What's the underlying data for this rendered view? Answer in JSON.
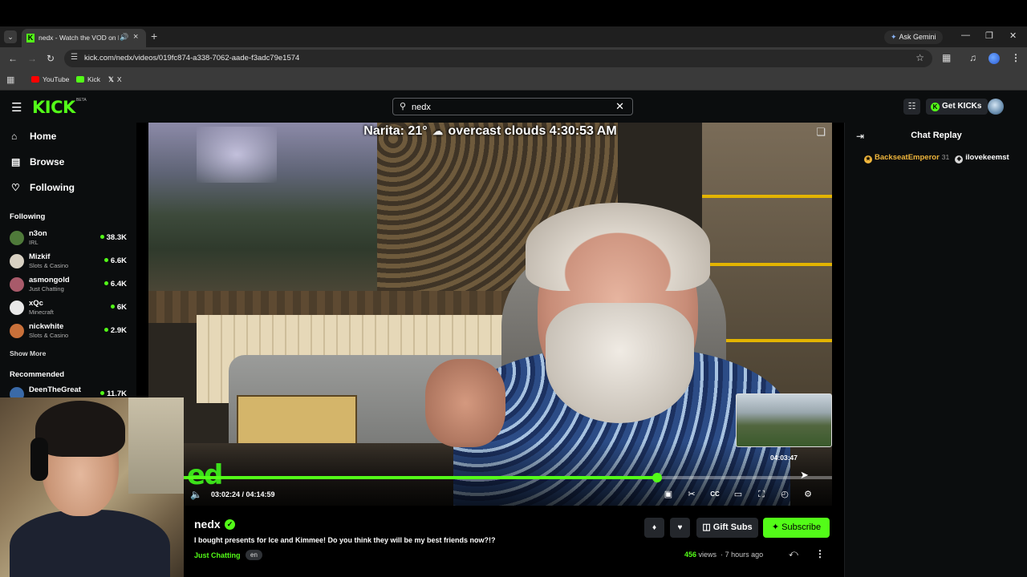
{
  "browser": {
    "tab_title": "nedx - Watch the VOD on Kick",
    "ask_gemini": "Ask Gemini",
    "url": "kick.com/nedx/videos/019fc874-a338-7062-aade-f3adc79e1574",
    "bookmarks": [
      "YouTube",
      "Kick",
      "X"
    ]
  },
  "header": {
    "logo": "KICK",
    "beta": "BETA",
    "search_value": "nedx",
    "get_kicks": "Get KICKs"
  },
  "sidebar": {
    "nav": [
      {
        "label": "Home",
        "icon": "home-icon"
      },
      {
        "label": "Browse",
        "icon": "browse-icon"
      },
      {
        "label": "Following",
        "icon": "heart-icon"
      }
    ],
    "following_heading": "Following",
    "following": [
      {
        "name": "n3on",
        "category": "IRL",
        "viewers": "38.3K",
        "color": "#4f7a3a"
      },
      {
        "name": "Mizkif",
        "category": "Slots & Casino",
        "viewers": "6.6K",
        "color": "#d8d1c2"
      },
      {
        "name": "asmongold",
        "category": "Just Chatting",
        "viewers": "6.4K",
        "color": "#a85a6a"
      },
      {
        "name": "xQc",
        "category": "Minecraft",
        "viewers": "6K",
        "color": "#e8e8e8"
      },
      {
        "name": "nickwhite",
        "category": "Slots & Casino",
        "viewers": "2.9K",
        "color": "#c8703a"
      }
    ],
    "show_more": "Show More",
    "recommended_heading": "Recommended",
    "recommended": [
      {
        "name": "DeenTheGreat",
        "viewers": "11.7K",
        "color": "#3a6aa8"
      }
    ]
  },
  "player": {
    "overlay_prefix": "Narita: 21°",
    "overlay_suffix": "overcast clouds 4:30:53 AM",
    "watermark": "ed",
    "progress_fraction": 0.73,
    "hover_time": "04:03:47",
    "time_display": "03:02:24 / 04:14:59"
  },
  "video": {
    "streamer": "nedx",
    "title": "I bought presents for Ice and Kimmee! Do you think they will be my best friends now?!?",
    "category": "Just Chatting",
    "language": "en",
    "gift_subs": "Gift Subs",
    "subscribe": "Subscribe",
    "views": "456",
    "views_label": "views",
    "age": "7 hours ago"
  },
  "chat": {
    "title": "Chat Replay",
    "user1": "BackseatEmperor",
    "user1_count": "31",
    "user2": "ilovekeemst"
  },
  "colors": {
    "accent": "#53fc18",
    "background": "#0b0d0e"
  }
}
